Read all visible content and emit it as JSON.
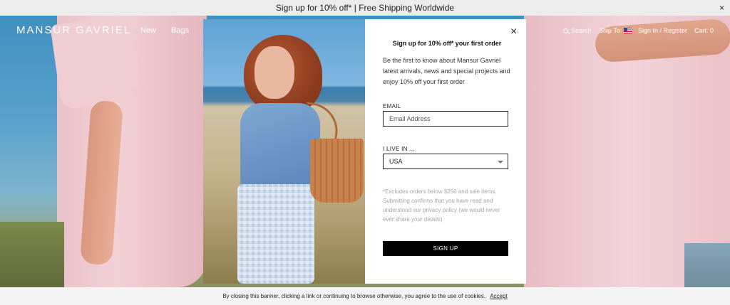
{
  "topbar": {
    "announcement": "Sign up for 10% off* | Free Shipping Worldwide",
    "close_glyph": "×"
  },
  "header": {
    "logo": "MANSUR GAVRIEL",
    "nav": [
      "New",
      "Bags"
    ],
    "search_label": "Search",
    "ship_to_label": "Ship To:",
    "ship_to_icon": "us-flag-icon",
    "signin_label": "Sign In / Register",
    "cart_label": "Cart: 0"
  },
  "modal": {
    "title": "Sign up for 10% off* your first order",
    "description": "Be the first to know about Mansur Gavriel latest arrivals, news and special projects and enjoy 10% off your first order",
    "email_label": "EMAIL",
    "email_placeholder": "Email Address",
    "email_value": "",
    "country_label": "I LIVE IN ...",
    "country_selected": "USA",
    "note": "*Excludes orders below $250 and sale items. Submitting confirms that you have read and understood our privacy policy (we would never ever share your details)",
    "submit_label": "SIGN UP",
    "close_glyph": "×"
  },
  "cookie_bar": {
    "message": "By closing this banner, clicking a link or continuing to browse otherwise, you agree to the use of cookies.",
    "accept_label": "Accept"
  },
  "colors": {
    "button_bg": "#000000",
    "topbar_bg": "#ececec",
    "cookie_bg": "#f4f4f4"
  }
}
